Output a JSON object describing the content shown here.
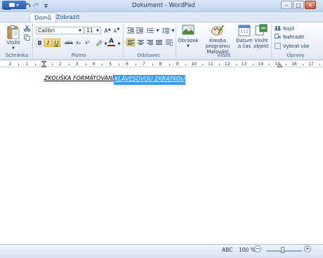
{
  "window": {
    "title": "Dokument - WordPad",
    "minimize_glyph": "–",
    "maximize_glyph": "□",
    "close_glyph": "✕"
  },
  "quick_access": {
    "save_icon": "save-icon",
    "undo_icon": "undo-icon",
    "redo_icon": "redo-icon",
    "customize_icon": "dropdown-icon"
  },
  "tabs": [
    {
      "label": "Domů",
      "active": true
    },
    {
      "label": "Zobrazit",
      "active": false
    }
  ],
  "ribbon": {
    "clipboard": {
      "group_label": "Schránka",
      "paste_label": "Vložit",
      "cut_icon": "scissors-icon",
      "copy_icon": "copy-icon"
    },
    "font": {
      "group_label": "Písmo",
      "font_name": "Calibri",
      "font_size": "11",
      "grow": "A▲",
      "shrink": "A▼",
      "bold": "B",
      "italic": "I",
      "underline": "U",
      "strike": "abc",
      "subscript": "x₂",
      "superscript": "x²",
      "highlight_icon": "highlighter-icon",
      "color": "A"
    },
    "paragraph": {
      "group_label": "Odstavec"
    },
    "insert": {
      "group_label": "Vložit",
      "picture_label": "Obrázek",
      "paint_label_1": "Kresba programu",
      "paint_label_2": "Malování",
      "datetime_label_1": "Datum",
      "datetime_label_2": "a čas",
      "object_label_1": "Vložit",
      "object_label_2": "objekt"
    },
    "editing": {
      "group_label": "Úpravy",
      "find": "Najít",
      "replace": "Nahradit",
      "select_all": "Vybrat vše"
    }
  },
  "ruler": {
    "marks": [
      "2",
      "1",
      "1",
      "2",
      "3",
      "4",
      "5",
      "6",
      "7",
      "8",
      "9",
      "10",
      "11",
      "12",
      "13",
      "14",
      "15",
      "16",
      "17"
    ]
  },
  "document": {
    "text_normal": "ZKOUŠKA FORMÁTOVÁNÍ ",
    "text_selected": "KLÁVESOVOU ZKRATKOU"
  },
  "status": {
    "spell": "ABC",
    "zoom": "100 %",
    "zoom_out": "−",
    "zoom_in": "+"
  },
  "colors": {
    "selection": "#3399ff",
    "active_button": "#fbc95a",
    "file_tab": "#2457a8",
    "font_color": "#c00000"
  }
}
